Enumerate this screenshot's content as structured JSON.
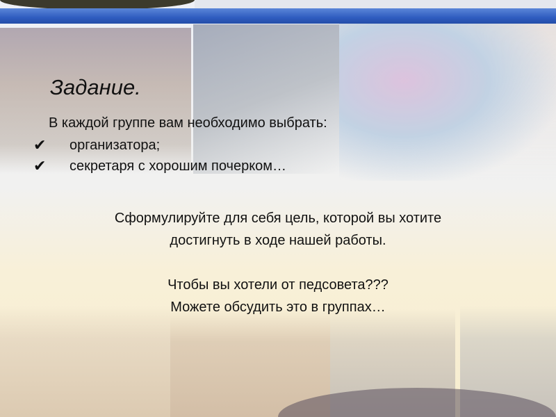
{
  "slide": {
    "title": "Задание.",
    "intro": "В каждой группе вам необходимо выбрать:",
    "items": [
      "организатора;",
      "секретаря с хорошим почерком…"
    ],
    "goal_line1": "Сформулируйте для себя цель, которой вы хотите",
    "goal_line2": "достигнуть в ходе нашей работы.",
    "question": "Чтобы вы хотели от педсовета???",
    "discuss": "Можете обсудить это в группах…"
  },
  "colors": {
    "band": "#2f5cc0",
    "background": "#f7edcf"
  }
}
